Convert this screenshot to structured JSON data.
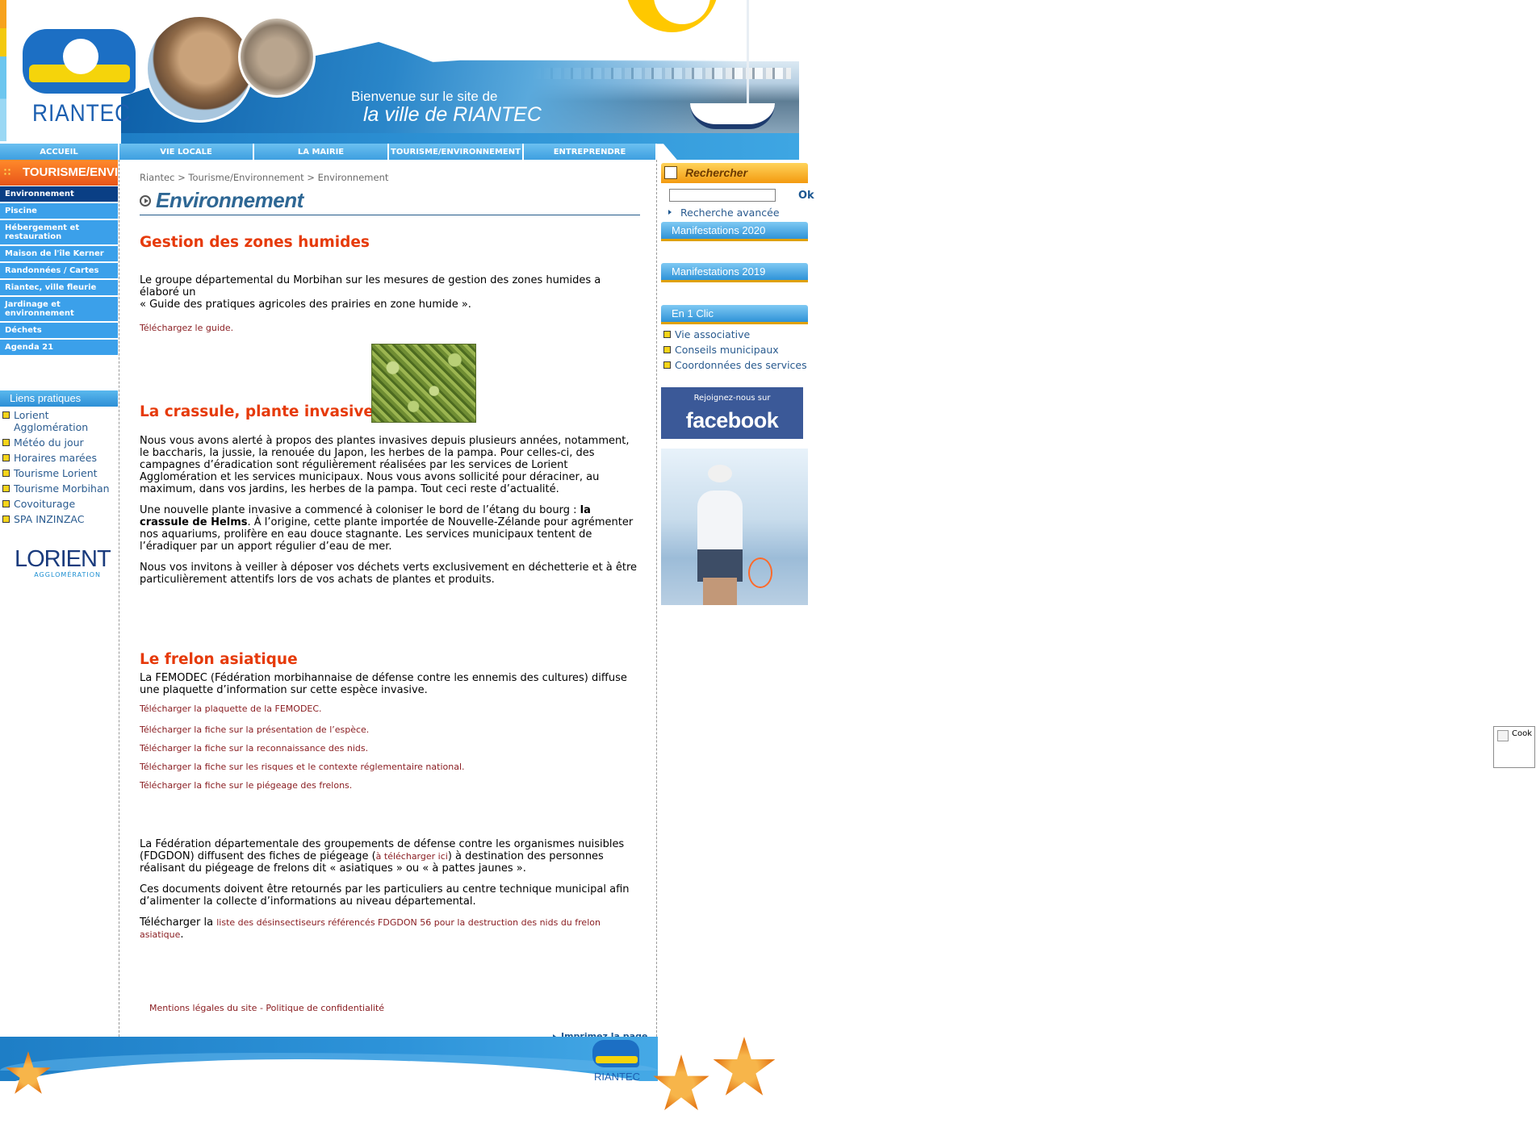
{
  "header": {
    "logo_text": "RIANTEC",
    "welcome_line1": "Bienvenue sur le site de",
    "welcome_line2": "la ville de RIANTEC"
  },
  "nav": {
    "tabs": [
      "ACCUEIL",
      "VIE LOCALE",
      "LA MAIRIE",
      "TOURISME/ENVIRONNEMENT",
      "ENTREPRENDRE"
    ]
  },
  "left": {
    "section_title": "TOURISME/ENVIRONNEMENT",
    "menu": [
      "Environnement",
      "Piscine",
      "Hébergement et restauration",
      "Maison de l'île Kerner",
      "Randonnées / Cartes",
      "Riantec, ville fleurie",
      "Jardinage et environnement",
      "Déchets",
      "Agenda 21"
    ],
    "liens_title": "Liens pratiques",
    "liens": [
      "Lorient Agglomération",
      "Météo du jour",
      "Horaires marées",
      "Tourisme Lorient",
      "Tourisme Morbihan",
      "Covoiturage",
      "SPA INZINZAC"
    ],
    "lorient_logo_main": "LORIENT",
    "lorient_logo_sub": "AGGLOMÉRATION"
  },
  "main": {
    "breadcrumb": "Riantec > Tourisme/Environnement > Environnement",
    "title": "Environnement",
    "s1": {
      "heading": "Gestion des zones humides",
      "p1a": "Le groupe départemental du Morbihan sur les mesures de gestion des zones humides a élaboré un",
      "p1b": "« Guide des pratiques agricoles des prairies en zone humide ».",
      "link": "Téléchargez le guide."
    },
    "s2": {
      "heading": "La crassule, plante invasive",
      "p1": "Nous vous avons alerté à propos des plantes invasives depuis plusieurs années, notamment, le baccharis, la jussie, la renouée du Japon, les herbes de la pampa. Pour celles-ci, des campagnes d’éradication sont régulièrement réalisées par les services de Lorient Agglomération et les services municipaux. Nous vous avons sollicité pour déraciner, au maximum, dans vos jardins, les herbes de la pampa. Tout ceci reste d’actualité.",
      "p2_before": "Une nouvelle plante invasive a commencé à coloniser le bord de l’étang du bourg : ",
      "p2_bold": "la crassule de Helms",
      "p2_after": ". À l’origine, cette plante importée de Nouvelle-Zélande pour agrémenter nos aquariums, prolifère en eau douce stagnante. Les services municipaux tentent de l’éradiquer par un apport régulier d’eau de mer.",
      "p3": "Nous vos invitons à veiller à déposer vos déchets verts exclusivement en déchetterie et à être particulièrement attentifs lors de vos achats de plantes et produits."
    },
    "s3": {
      "heading": "Le frelon asiatique",
      "p1": "La FEMODEC (Fédération morbihannaise de défense contre les ennemis des cultures) diffuse une plaquette d’information sur cette espèce invasive.",
      "links": [
        "Télécharger la plaquette de la FEMODEC.",
        "Télécharger la fiche sur la présentation de l’espèce.",
        "Télécharger la fiche sur la reconnaissance des nids.",
        "Télécharger la fiche sur les risques et le contexte réglementaire national.",
        "Télécharger la fiche sur le piégeage des frelons."
      ],
      "p2_before": "La Fédération départementale des groupements de défense contre les organismes nuisibles (FDGDON) diffusent des fiches de piégeage (",
      "p2_link": "à télécharger ici",
      "p2_after": ") à destination des personnes réalisant du piégeage de frelons dit « asiatiques » ou « à pattes jaunes ».",
      "p3": "Ces documents doivent être retournés par les particuliers au centre technique municipal afin d’alimenter la collecte d’informations au niveau départemental.",
      "p4_before": "Télécharger la ",
      "p4_link": "liste des désinsectiseurs référencés FDGDON 56 pour la destruction des nids du frelon asiatique",
      "p4_after": "."
    },
    "footer_links": {
      "mentions": "Mentions légales du site",
      "sep": " - ",
      "privacy": "Politique de confidentialité"
    },
    "print": "Imprimez la page"
  },
  "right": {
    "search_title": "Rechercher",
    "search_placeholder": "",
    "ok": "Ok",
    "advanced": "Recherche avancée",
    "box1": "Manifestations 2020",
    "box2": "Manifestations 2019",
    "box3": "En 1 Clic",
    "clic": [
      "Vie associative",
      "Conseils municipaux",
      "Coordonnées des services"
    ],
    "fb_small": "Rejoignez-nous sur",
    "fb_big": "facebook"
  },
  "footer": {
    "logo_text": "RIANTEC"
  },
  "cookie": {
    "label": "Cook"
  },
  "colors": {
    "heading_red": "#e63a0a",
    "link_dark_red": "#8a1e22",
    "nav_blue": "#3ba0ea",
    "active_navy": "#0a3f85",
    "facebook": "#3b5998"
  }
}
